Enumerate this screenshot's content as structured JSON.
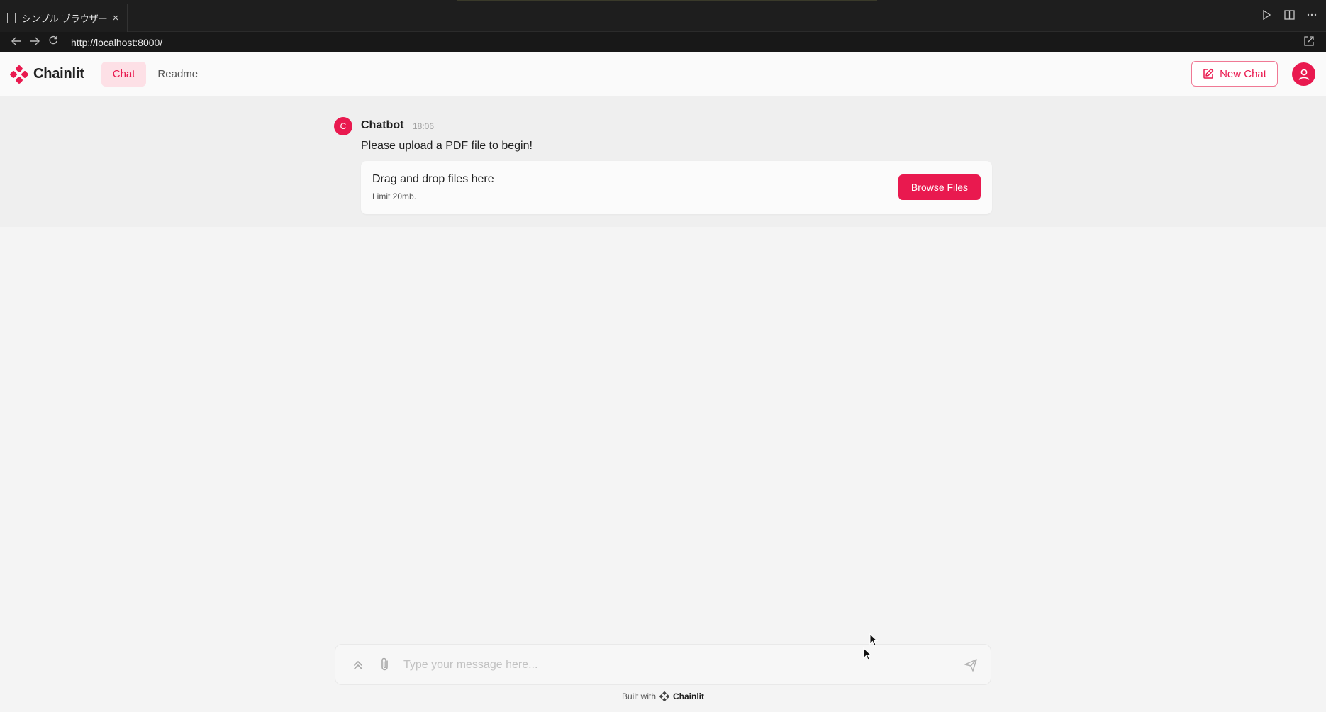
{
  "browser": {
    "tab_title": "シンプル ブラウザー",
    "tab_close": "×",
    "url": "http://localhost:8000/"
  },
  "app": {
    "brand": "Chainlit",
    "nav_tabs": [
      {
        "label": "Chat",
        "active": true
      },
      {
        "label": "Readme",
        "active": false
      }
    ],
    "new_chat_label": "New Chat",
    "accent_color": "#e9194f"
  },
  "message": {
    "avatar_initial": "C",
    "author": "Chatbot",
    "time": "18:06",
    "text": "Please upload a PDF file to begin!",
    "upload": {
      "title": "Drag and drop files here",
      "limit": "Limit 20mb.",
      "button_label": "Browse Files"
    }
  },
  "composer": {
    "placeholder": "Type your message here..."
  },
  "footer": {
    "built_with": "Built with",
    "brand": "Chainlit"
  }
}
